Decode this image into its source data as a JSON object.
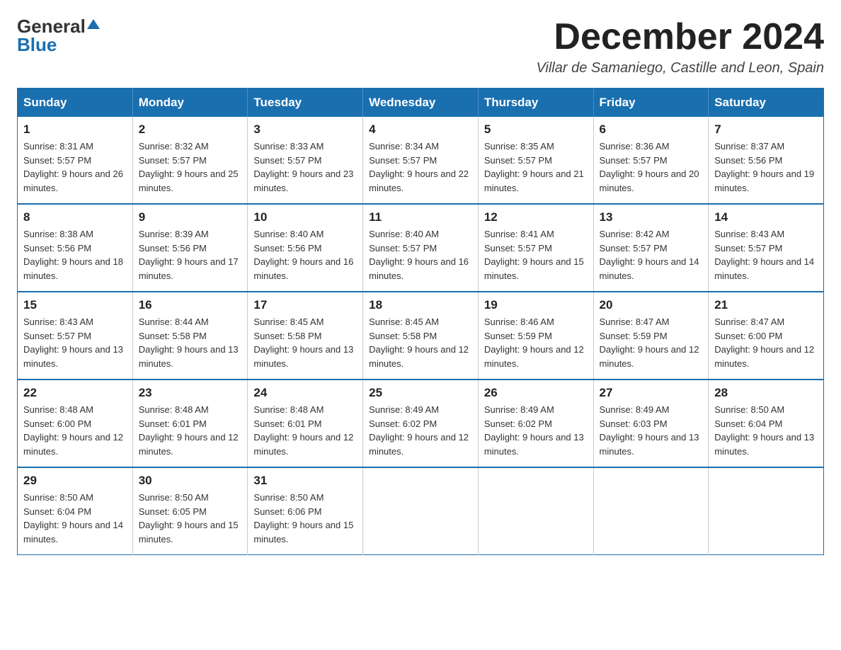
{
  "logo": {
    "general": "General",
    "blue": "Blue"
  },
  "title": {
    "month": "December 2024",
    "location": "Villar de Samaniego, Castille and Leon, Spain"
  },
  "header_days": [
    "Sunday",
    "Monday",
    "Tuesday",
    "Wednesday",
    "Thursday",
    "Friday",
    "Saturday"
  ],
  "weeks": [
    [
      {
        "day": "1",
        "sunrise": "Sunrise: 8:31 AM",
        "sunset": "Sunset: 5:57 PM",
        "daylight": "Daylight: 9 hours and 26 minutes."
      },
      {
        "day": "2",
        "sunrise": "Sunrise: 8:32 AM",
        "sunset": "Sunset: 5:57 PM",
        "daylight": "Daylight: 9 hours and 25 minutes."
      },
      {
        "day": "3",
        "sunrise": "Sunrise: 8:33 AM",
        "sunset": "Sunset: 5:57 PM",
        "daylight": "Daylight: 9 hours and 23 minutes."
      },
      {
        "day": "4",
        "sunrise": "Sunrise: 8:34 AM",
        "sunset": "Sunset: 5:57 PM",
        "daylight": "Daylight: 9 hours and 22 minutes."
      },
      {
        "day": "5",
        "sunrise": "Sunrise: 8:35 AM",
        "sunset": "Sunset: 5:57 PM",
        "daylight": "Daylight: 9 hours and 21 minutes."
      },
      {
        "day": "6",
        "sunrise": "Sunrise: 8:36 AM",
        "sunset": "Sunset: 5:57 PM",
        "daylight": "Daylight: 9 hours and 20 minutes."
      },
      {
        "day": "7",
        "sunrise": "Sunrise: 8:37 AM",
        "sunset": "Sunset: 5:56 PM",
        "daylight": "Daylight: 9 hours and 19 minutes."
      }
    ],
    [
      {
        "day": "8",
        "sunrise": "Sunrise: 8:38 AM",
        "sunset": "Sunset: 5:56 PM",
        "daylight": "Daylight: 9 hours and 18 minutes."
      },
      {
        "day": "9",
        "sunrise": "Sunrise: 8:39 AM",
        "sunset": "Sunset: 5:56 PM",
        "daylight": "Daylight: 9 hours and 17 minutes."
      },
      {
        "day": "10",
        "sunrise": "Sunrise: 8:40 AM",
        "sunset": "Sunset: 5:56 PM",
        "daylight": "Daylight: 9 hours and 16 minutes."
      },
      {
        "day": "11",
        "sunrise": "Sunrise: 8:40 AM",
        "sunset": "Sunset: 5:57 PM",
        "daylight": "Daylight: 9 hours and 16 minutes."
      },
      {
        "day": "12",
        "sunrise": "Sunrise: 8:41 AM",
        "sunset": "Sunset: 5:57 PM",
        "daylight": "Daylight: 9 hours and 15 minutes."
      },
      {
        "day": "13",
        "sunrise": "Sunrise: 8:42 AM",
        "sunset": "Sunset: 5:57 PM",
        "daylight": "Daylight: 9 hours and 14 minutes."
      },
      {
        "day": "14",
        "sunrise": "Sunrise: 8:43 AM",
        "sunset": "Sunset: 5:57 PM",
        "daylight": "Daylight: 9 hours and 14 minutes."
      }
    ],
    [
      {
        "day": "15",
        "sunrise": "Sunrise: 8:43 AM",
        "sunset": "Sunset: 5:57 PM",
        "daylight": "Daylight: 9 hours and 13 minutes."
      },
      {
        "day": "16",
        "sunrise": "Sunrise: 8:44 AM",
        "sunset": "Sunset: 5:58 PM",
        "daylight": "Daylight: 9 hours and 13 minutes."
      },
      {
        "day": "17",
        "sunrise": "Sunrise: 8:45 AM",
        "sunset": "Sunset: 5:58 PM",
        "daylight": "Daylight: 9 hours and 13 minutes."
      },
      {
        "day": "18",
        "sunrise": "Sunrise: 8:45 AM",
        "sunset": "Sunset: 5:58 PM",
        "daylight": "Daylight: 9 hours and 12 minutes."
      },
      {
        "day": "19",
        "sunrise": "Sunrise: 8:46 AM",
        "sunset": "Sunset: 5:59 PM",
        "daylight": "Daylight: 9 hours and 12 minutes."
      },
      {
        "day": "20",
        "sunrise": "Sunrise: 8:47 AM",
        "sunset": "Sunset: 5:59 PM",
        "daylight": "Daylight: 9 hours and 12 minutes."
      },
      {
        "day": "21",
        "sunrise": "Sunrise: 8:47 AM",
        "sunset": "Sunset: 6:00 PM",
        "daylight": "Daylight: 9 hours and 12 minutes."
      }
    ],
    [
      {
        "day": "22",
        "sunrise": "Sunrise: 8:48 AM",
        "sunset": "Sunset: 6:00 PM",
        "daylight": "Daylight: 9 hours and 12 minutes."
      },
      {
        "day": "23",
        "sunrise": "Sunrise: 8:48 AM",
        "sunset": "Sunset: 6:01 PM",
        "daylight": "Daylight: 9 hours and 12 minutes."
      },
      {
        "day": "24",
        "sunrise": "Sunrise: 8:48 AM",
        "sunset": "Sunset: 6:01 PM",
        "daylight": "Daylight: 9 hours and 12 minutes."
      },
      {
        "day": "25",
        "sunrise": "Sunrise: 8:49 AM",
        "sunset": "Sunset: 6:02 PM",
        "daylight": "Daylight: 9 hours and 12 minutes."
      },
      {
        "day": "26",
        "sunrise": "Sunrise: 8:49 AM",
        "sunset": "Sunset: 6:02 PM",
        "daylight": "Daylight: 9 hours and 13 minutes."
      },
      {
        "day": "27",
        "sunrise": "Sunrise: 8:49 AM",
        "sunset": "Sunset: 6:03 PM",
        "daylight": "Daylight: 9 hours and 13 minutes."
      },
      {
        "day": "28",
        "sunrise": "Sunrise: 8:50 AM",
        "sunset": "Sunset: 6:04 PM",
        "daylight": "Daylight: 9 hours and 13 minutes."
      }
    ],
    [
      {
        "day": "29",
        "sunrise": "Sunrise: 8:50 AM",
        "sunset": "Sunset: 6:04 PM",
        "daylight": "Daylight: 9 hours and 14 minutes."
      },
      {
        "day": "30",
        "sunrise": "Sunrise: 8:50 AM",
        "sunset": "Sunset: 6:05 PM",
        "daylight": "Daylight: 9 hours and 15 minutes."
      },
      {
        "day": "31",
        "sunrise": "Sunrise: 8:50 AM",
        "sunset": "Sunset: 6:06 PM",
        "daylight": "Daylight: 9 hours and 15 minutes."
      },
      null,
      null,
      null,
      null
    ]
  ]
}
